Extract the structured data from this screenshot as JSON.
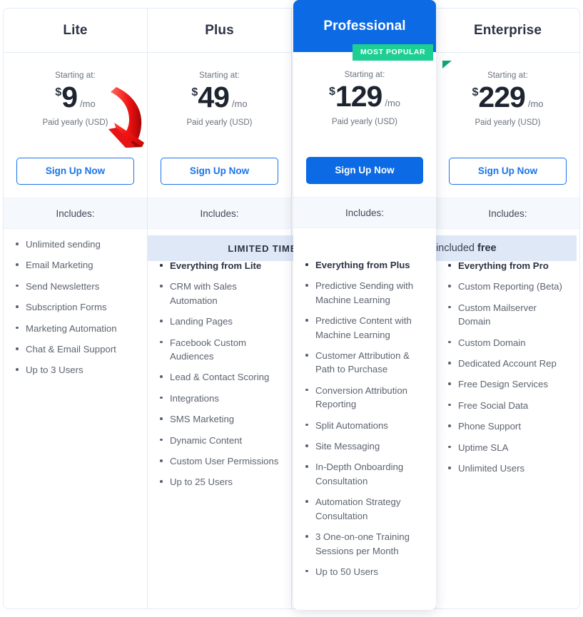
{
  "plans": [
    {
      "name": "Lite",
      "featured": false,
      "starting_label": "Starting at:",
      "currency": "$",
      "amount": "9",
      "period": "/mo",
      "billing_note": "Paid yearly (USD)",
      "cta_label": "Sign Up Now",
      "includes_label": "Includes:",
      "features": [
        {
          "text": "Unlimited sending",
          "bold": false
        },
        {
          "text": "Email Marketing",
          "bold": false
        },
        {
          "text": "Send Newsletters",
          "bold": false
        },
        {
          "text": "Subscription Forms",
          "bold": false
        },
        {
          "text": "Marketing Automation",
          "bold": false
        },
        {
          "text": "Chat & Email Support",
          "bold": false
        },
        {
          "text": "Up to 3 Users",
          "bold": false
        }
      ]
    },
    {
      "name": "Plus",
      "featured": false,
      "starting_label": "Starting at:",
      "currency": "$",
      "amount": "49",
      "period": "/mo",
      "billing_note": "Paid yearly (USD)",
      "cta_label": "Sign Up Now",
      "includes_label": "Includes:",
      "features": [
        {
          "text": "Everything from Lite",
          "bold": true
        },
        {
          "text": "CRM with Sales Automation",
          "bold": false
        },
        {
          "text": "Landing Pages",
          "bold": false
        },
        {
          "text": "Facebook Custom Audiences",
          "bold": false
        },
        {
          "text": "Lead & Contact Scoring",
          "bold": false
        },
        {
          "text": "Integrations",
          "bold": false
        },
        {
          "text": "SMS Marketing",
          "bold": false
        },
        {
          "text": "Dynamic Content",
          "bold": false
        },
        {
          "text": "Custom User Permissions",
          "bold": false
        },
        {
          "text": "Up to 25 Users",
          "bold": false
        }
      ]
    },
    {
      "name": "Professional",
      "featured": true,
      "badge": "MOST POPULAR",
      "starting_label": "Starting at:",
      "currency": "$",
      "amount": "129",
      "period": "/mo",
      "billing_note": "Paid yearly (USD)",
      "cta_label": "Sign Up Now",
      "includes_label": "Includes:",
      "features": [
        {
          "text": "Everything from Plus",
          "bold": true
        },
        {
          "text": "Predictive Sending with Machine Learning",
          "bold": false
        },
        {
          "text": "Predictive Content with Machine Learning",
          "bold": false
        },
        {
          "text": "Customer Attribution & Path to Purchase",
          "bold": false
        },
        {
          "text": "Conversion Attribution Reporting",
          "bold": false
        },
        {
          "text": "Split Automations",
          "bold": false
        },
        {
          "text": "Site Messaging",
          "bold": false
        },
        {
          "text": "In-Depth Onboarding Consultation",
          "bold": false
        },
        {
          "text": "Automation Strategy Consultation",
          "bold": false
        },
        {
          "text": "3 One-on-one Training Sessions per Month",
          "bold": false
        },
        {
          "text": "Up to 50 Users",
          "bold": false
        }
      ]
    },
    {
      "name": "Enterprise",
      "featured": false,
      "starting_label": "Starting at:",
      "currency": "$",
      "amount": "229",
      "period": "/mo",
      "billing_note": "Paid yearly (USD)",
      "cta_label": "Sign Up Now",
      "includes_label": "Includes:",
      "features": [
        {
          "text": "Everything from Pro",
          "bold": true
        },
        {
          "text": "Custom Reporting (Beta)",
          "bold": false
        },
        {
          "text": "Custom Mailserver Domain",
          "bold": false
        },
        {
          "text": "Custom Domain",
          "bold": false
        },
        {
          "text": "Dedicated Account Rep",
          "bold": false
        },
        {
          "text": "Free Design Services",
          "bold": false
        },
        {
          "text": "Free Social Data",
          "bold": false
        },
        {
          "text": "Phone Support",
          "bold": false
        },
        {
          "text": "Uptime SLA",
          "bold": false
        },
        {
          "text": "Unlimited Users",
          "bold": false
        }
      ]
    }
  ],
  "promo_banner": {
    "eyebrow": "LIMITED TIME",
    "message_prefix": "CRM with Sales Automation included ",
    "message_emphasis": "free"
  },
  "annotation": {
    "type": "red-curved-arrow",
    "points_to": "lite-signup-button",
    "color": "#f01d1d"
  },
  "colors": {
    "accent_blue": "#0b6ae4",
    "link_blue": "#1a73e8",
    "ribbon_green": "#1ecf93",
    "ribbon_fold": "#12a374",
    "includes_band": "#f5f8fc",
    "promo_band": "#dee8f7",
    "border": "#e3ebf8",
    "heading_text": "#2c3344",
    "body_text": "#5c6370",
    "muted_text": "#6b7280"
  }
}
